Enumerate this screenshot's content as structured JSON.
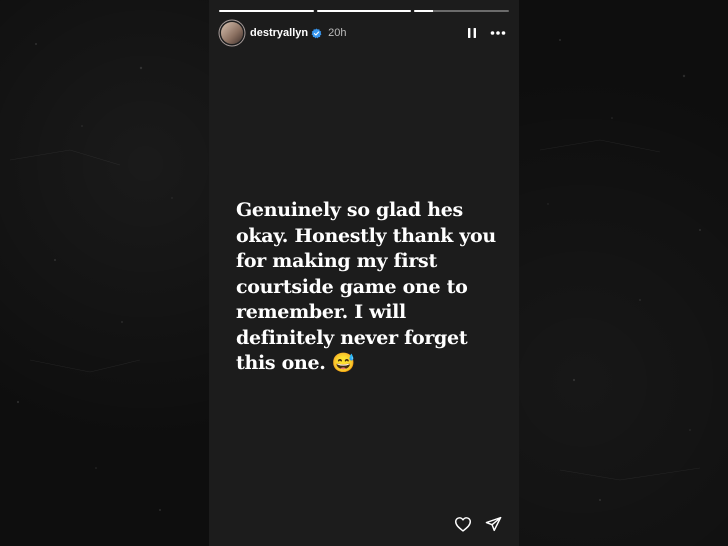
{
  "story": {
    "progress": [
      1,
      1,
      0.2
    ],
    "header": {
      "username": "destryallyn",
      "verified": true,
      "time": "20h"
    },
    "message": {
      "lines": [
        "Genuinely so glad hes",
        "okay. Honestly thank you",
        "for making my first",
        "courtside game one to",
        "remember. I will",
        "definitely never forget",
        "this one. 😅"
      ]
    }
  },
  "icons": {
    "avatar": "profile-avatar",
    "verified": "verified-badge-icon",
    "pause": "pause-icon",
    "more": "more-options-icon",
    "like": "heart-icon",
    "share": "send-icon"
  }
}
